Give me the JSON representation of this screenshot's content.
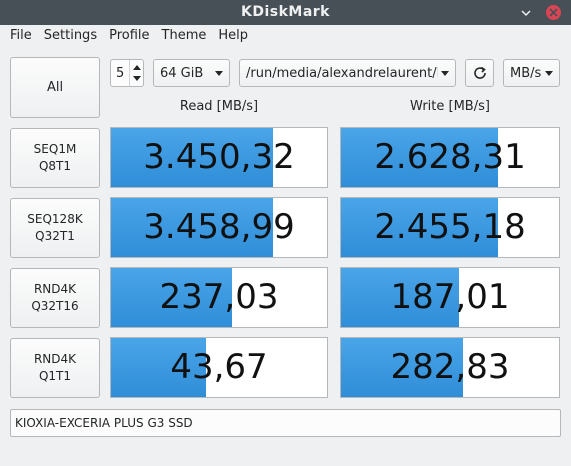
{
  "window": {
    "title": "KDiskMark"
  },
  "menu": [
    "File",
    "Settings",
    "Profile",
    "Theme",
    "Help"
  ],
  "toolbar": {
    "all_label": "All",
    "runs": "5",
    "size": "64 GiB",
    "path": "/run/media/alexandrelaurent/KIO",
    "unit": "MB/s"
  },
  "headers": {
    "read": "Read [MB/s]",
    "write": "Write [MB/s]"
  },
  "tests": [
    {
      "line1": "SEQ1M",
      "line2": "Q8T1",
      "read": "3.450,32",
      "read_fill": 0.75,
      "write": "2.628,31",
      "write_fill": 0.72
    },
    {
      "line1": "SEQ128K",
      "line2": "Q32T1",
      "read": "3.458,99",
      "read_fill": 0.75,
      "write": "2.455,18",
      "write_fill": 0.72
    },
    {
      "line1": "RND4K",
      "line2": "Q32T16",
      "read": "237,03",
      "read_fill": 0.56,
      "write": "187,01",
      "write_fill": 0.54
    },
    {
      "line1": "RND4K",
      "line2": "Q1T1",
      "read": "43,67",
      "read_fill": 0.44,
      "write": "282,83",
      "write_fill": 0.56
    }
  ],
  "device": {
    "name": "KIOXIA-EXCERIA PLUS G3 SSD"
  }
}
